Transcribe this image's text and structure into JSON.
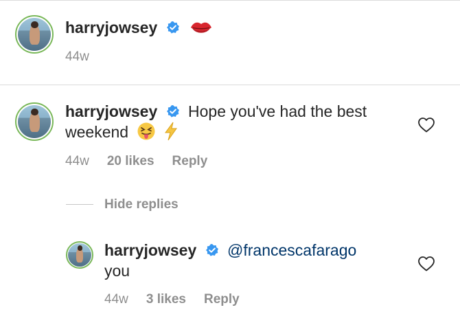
{
  "caption": {
    "username": "harryjowsey",
    "emoji": "kiss-lips-emoji",
    "timestamp": "44w"
  },
  "comment": {
    "username": "harryjowsey",
    "text_line1": "Hope you've had the best",
    "text_line2": "weekend",
    "emojis": [
      "squinting-tongue-emoji",
      "lightning-emoji"
    ],
    "timestamp": "44w",
    "likes": "20 likes",
    "reply_label": "Reply"
  },
  "hide_replies_label": "Hide replies",
  "reply": {
    "username": "harryjowsey",
    "mention": "@francescafarago",
    "text_line2": "you",
    "timestamp": "44w",
    "likes": "3 likes",
    "reply_label": "Reply"
  },
  "colors": {
    "verified": "#3897f0",
    "mention": "#003569",
    "meta": "#8e8e8e",
    "kiss": "#d8262e",
    "lightning": "#f5c542"
  }
}
